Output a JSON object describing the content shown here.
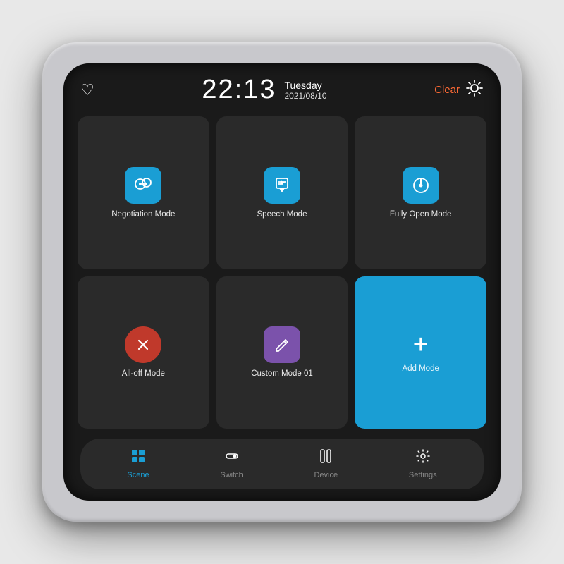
{
  "header": {
    "time": "22:13",
    "day": "Tuesday",
    "date": "2021/08/10",
    "weather_label": "Clear",
    "heart_char": "♡"
  },
  "tiles": [
    {
      "id": "negotiation-mode",
      "label": "Negotiation Mode",
      "icon_type": "chat",
      "icon_bg": "blue"
    },
    {
      "id": "speech-mode",
      "label": "Speech Mode",
      "icon_type": "presentation",
      "icon_bg": "blue"
    },
    {
      "id": "fully-open-mode",
      "label": "Fully Open Mode",
      "icon_type": "power",
      "icon_bg": "blue"
    },
    {
      "id": "all-off-mode",
      "label": "All-off Mode",
      "icon_type": "close",
      "icon_bg": "pink"
    },
    {
      "id": "custom-mode-01",
      "label": "Custom Mode 01",
      "icon_type": "edit",
      "icon_bg": "purple"
    },
    {
      "id": "add-mode",
      "label": "Add Mode",
      "icon_type": "add",
      "icon_bg": "teal"
    }
  ],
  "nav": {
    "items": [
      {
        "id": "scene",
        "label": "Scene",
        "icon": "scene",
        "active": true
      },
      {
        "id": "switch",
        "label": "Switch",
        "icon": "switch",
        "active": false
      },
      {
        "id": "device",
        "label": "Device",
        "icon": "device",
        "active": false
      },
      {
        "id": "settings",
        "label": "Settings",
        "icon": "settings",
        "active": false
      }
    ]
  }
}
